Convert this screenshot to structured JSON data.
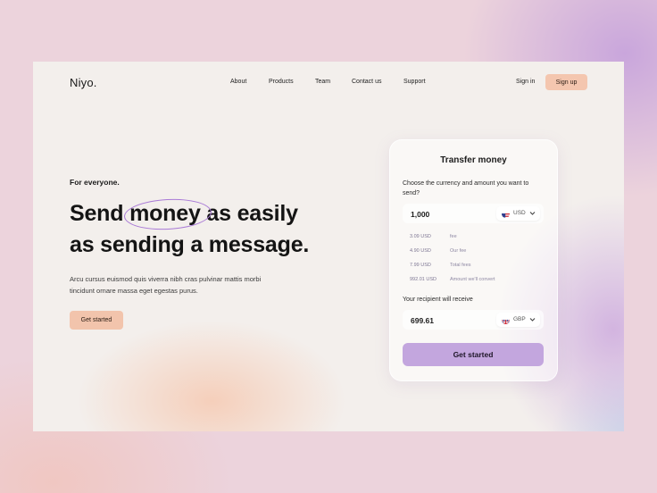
{
  "brand": {
    "logo": "Niyo."
  },
  "nav": {
    "items": [
      {
        "label": "About"
      },
      {
        "label": "Products"
      },
      {
        "label": "Team"
      },
      {
        "label": "Contact us"
      },
      {
        "label": "Support"
      }
    ],
    "sign_in": "Sign in",
    "sign_up": "Sign up"
  },
  "hero": {
    "eyebrow": "For everyone.",
    "headline_part1": "Send",
    "headline_highlight": "money",
    "headline_part2": "as easily",
    "headline_line2": "as sending a message.",
    "description": "Arcu cursus euismod quis viverra nibh cras pulvinar mattis morbi tincidunt ornare massa eget egestas purus.",
    "cta": "Get started"
  },
  "transfer": {
    "title": "Transfer money",
    "prompt": "Choose the currency and amount you want to send?",
    "send": {
      "amount": "1,000",
      "currency": "USD",
      "flag_icon": "us-flag-icon"
    },
    "fees": [
      {
        "amount": "3.09 USD",
        "label": "fee"
      },
      {
        "amount": "4.90 USD",
        "label": "Our fee"
      },
      {
        "amount": "7.99 USD",
        "label": "Total fees"
      },
      {
        "amount": "992.01 USD",
        "label": "Amount we'll convert"
      }
    ],
    "recipient_label": "Your recipient will receive",
    "receive": {
      "amount": "699.61",
      "currency": "GBP",
      "flag_icon": "uk-flag-icon"
    },
    "button": "Get started"
  },
  "colors": {
    "accent_peach": "#f2c4ac",
    "accent_lavender": "#c3a6de",
    "highlight_ring": "#a97ad6"
  }
}
